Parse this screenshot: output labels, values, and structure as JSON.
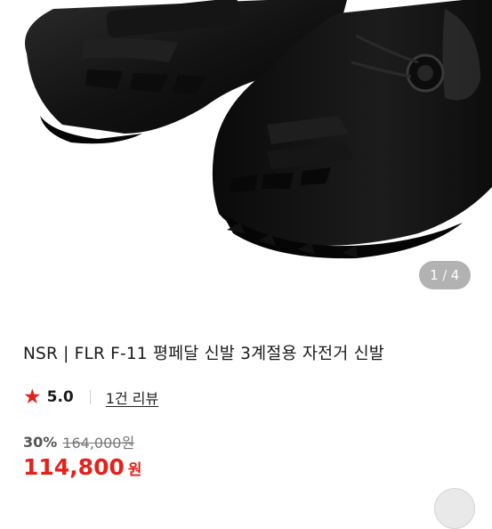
{
  "product": {
    "image_alt": "Black FLR F-11 cycling shoes",
    "image_index": "1",
    "image_separator": "/",
    "image_total": "4",
    "title": "NSR | FLR F-11 평페달 신발 3계절용 자전거 신발"
  },
  "rating": {
    "star_icon": "★",
    "score": "5.0",
    "review_link": "1건 리뷰"
  },
  "price": {
    "discount": "30%",
    "original": "164,000원",
    "final": "114,800",
    "unit": "원"
  },
  "colors": {
    "accent": "#e3231b",
    "star": "#e2211c"
  }
}
